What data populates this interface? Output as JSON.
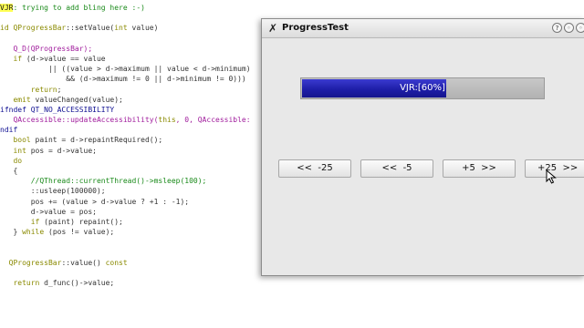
{
  "editor": {
    "lines": [
      [
        {
          "t": "VJR",
          "c": "c-highlight"
        },
        {
          "t": ": trying to add bling here :-)",
          "c": "c-comment"
        }
      ],
      [
        {
          "t": "",
          "c": "c-default"
        }
      ],
      [
        {
          "t": "id ",
          "c": "c-keyword"
        },
        {
          "t": "QProgressBar",
          "c": "c-type"
        },
        {
          "t": "::setValue(",
          "c": "c-default"
        },
        {
          "t": "int",
          "c": "c-keyword"
        },
        {
          "t": " value)",
          "c": "c-default"
        }
      ],
      [
        {
          "t": "",
          "c": "c-default"
        }
      ],
      [
        {
          "t": "   Q_D(QProgressBar);",
          "c": "c-func"
        }
      ],
      [
        {
          "t": "   ",
          "c": "c-default"
        },
        {
          "t": "if",
          "c": "c-keyword"
        },
        {
          "t": " (d->value == value",
          "c": "c-default"
        }
      ],
      [
        {
          "t": "           || ((value > d->maximum || value < d->minimum)",
          "c": "c-default"
        }
      ],
      [
        {
          "t": "               && (d->maximum != 0 || d->minimum != 0)))",
          "c": "c-default"
        }
      ],
      [
        {
          "t": "       ",
          "c": "c-default"
        },
        {
          "t": "return",
          "c": "c-keyword"
        },
        {
          "t": ";",
          "c": "c-default"
        }
      ],
      [
        {
          "t": "   ",
          "c": "c-default"
        },
        {
          "t": "emit",
          "c": "c-keyword"
        },
        {
          "t": " valueChanged(value);",
          "c": "c-default"
        }
      ],
      [
        {
          "t": "ifndef QT_NO_ACCESSIBILITY",
          "c": "c-preproc"
        }
      ],
      [
        {
          "t": "   QAccessible::updateAccessibility(",
          "c": "c-func"
        },
        {
          "t": "this",
          "c": "c-keyword"
        },
        {
          "t": ", 0, QAccessible:",
          "c": "c-func"
        }
      ],
      [
        {
          "t": "ndif",
          "c": "c-preproc"
        }
      ],
      [
        {
          "t": "   ",
          "c": "c-default"
        },
        {
          "t": "bool",
          "c": "c-keyword"
        },
        {
          "t": " paint = d->repaintRequired();",
          "c": "c-default"
        }
      ],
      [
        {
          "t": "   ",
          "c": "c-default"
        },
        {
          "t": "int",
          "c": "c-keyword"
        },
        {
          "t": " pos = d->value;",
          "c": "c-default"
        }
      ],
      [
        {
          "t": "   ",
          "c": "c-default"
        },
        {
          "t": "do",
          "c": "c-keyword"
        }
      ],
      [
        {
          "t": "   {",
          "c": "c-default"
        }
      ],
      [
        {
          "t": "       //QThread::currentThread()->msleep(100);",
          "c": "c-comment"
        }
      ],
      [
        {
          "t": "       ::usleep(100000);",
          "c": "c-default"
        }
      ],
      [
        {
          "t": "       pos += (value > d->value ? +1 : -1);",
          "c": "c-default"
        }
      ],
      [
        {
          "t": "       d->value = pos;",
          "c": "c-default"
        }
      ],
      [
        {
          "t": "       ",
          "c": "c-default"
        },
        {
          "t": "if",
          "c": "c-keyword"
        },
        {
          "t": " (paint) repaint();",
          "c": "c-default"
        }
      ],
      [
        {
          "t": "   } ",
          "c": "c-default"
        },
        {
          "t": "while",
          "c": "c-keyword"
        },
        {
          "t": " (pos != value);",
          "c": "c-default"
        }
      ],
      [
        {
          "t": "",
          "c": "c-default"
        }
      ],
      [
        {
          "t": "",
          "c": "c-default"
        }
      ],
      [
        {
          "t": "  ",
          "c": "c-default"
        },
        {
          "t": "QProgressBar",
          "c": "c-type"
        },
        {
          "t": "::value() ",
          "c": "c-default"
        },
        {
          "t": "const",
          "c": "c-keyword"
        }
      ],
      [
        {
          "t": "",
          "c": "c-default"
        }
      ],
      [
        {
          "t": "   ",
          "c": "c-default"
        },
        {
          "t": "return",
          "c": "c-keyword"
        },
        {
          "t": " d_func()->value;",
          "c": "c-default"
        }
      ]
    ]
  },
  "window": {
    "title": "ProgressTest",
    "icon": "x-app-icon",
    "controls": {
      "help": "?",
      "minimize": "◦",
      "maximize": "◦"
    }
  },
  "progress": {
    "label": "VJR:[60%]",
    "value": 0.6
  },
  "buttons": {
    "minus25": "<<  -25",
    "minus5": "<<  -5",
    "plus5": "+5  >>",
    "plus25": "+25  >>"
  },
  "colors": {
    "progress_fill": "#1e1ea8",
    "highlight": "#ffff55"
  }
}
